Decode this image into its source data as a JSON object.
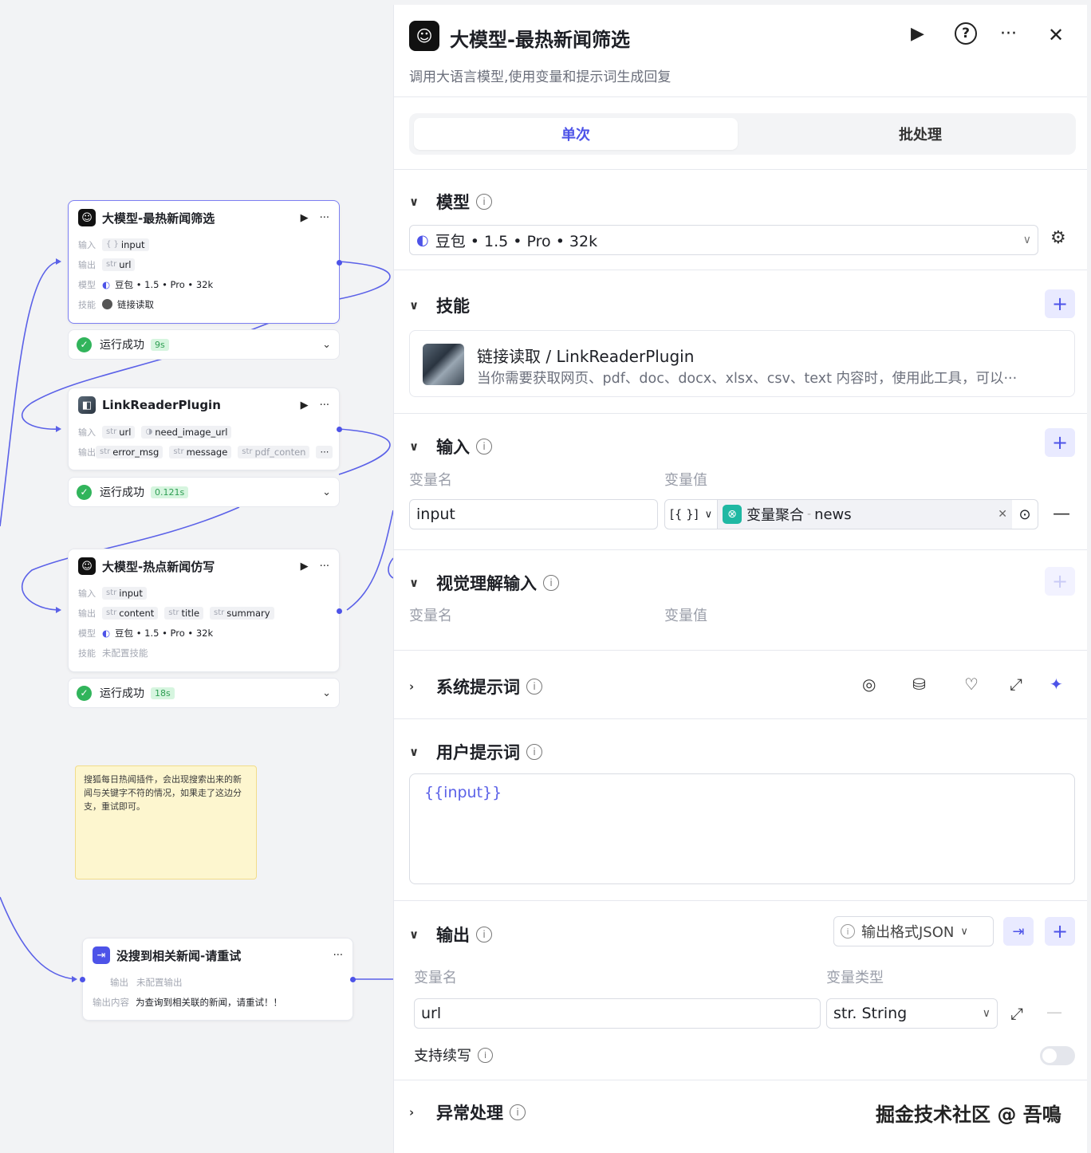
{
  "canvas": {
    "nodes": [
      {
        "title": "大模型-最热新闻筛选",
        "rows": [
          {
            "label": "输入",
            "items": [
              {
                "type": "{ }",
                "name": "input"
              }
            ]
          },
          {
            "label": "输出",
            "items": [
              {
                "type": "str",
                "name": "url"
              }
            ]
          },
          {
            "label": "模型",
            "text": "豆包 • 1.5 • Pro • 32k"
          },
          {
            "label": "技能",
            "text": "链接读取"
          }
        ],
        "status": "运行成功",
        "duration": "9s"
      },
      {
        "title": "LinkReaderPlugin",
        "rows": [
          {
            "label": "输入",
            "items": [
              {
                "type": "str",
                "name": "url"
              },
              {
                "type": "",
                "name": "need_image_url"
              }
            ]
          },
          {
            "label": "输出",
            "items": [
              {
                "type": "str",
                "name": "error_msg"
              },
              {
                "type": "str",
                "name": "message"
              },
              {
                "type": "str",
                "name": "pdf_conten"
              }
            ],
            "more": "···"
          }
        ],
        "status": "运行成功",
        "duration": "0.121s"
      },
      {
        "title": "大模型-热点新闻仿写",
        "rows": [
          {
            "label": "输入",
            "items": [
              {
                "type": "str",
                "name": "input"
              }
            ]
          },
          {
            "label": "输出",
            "items": [
              {
                "type": "str",
                "name": "content"
              },
              {
                "type": "str",
                "name": "title"
              },
              {
                "type": "str",
                "name": "summary"
              }
            ]
          },
          {
            "label": "模型",
            "text": "豆包 • 1.5 • Pro • 32k"
          },
          {
            "label": "技能",
            "text": "未配置技能"
          }
        ],
        "status": "运行成功",
        "duration": "18s"
      }
    ],
    "note": "搜狐每日热闻插件，会出现搜索出来的新闻与关键字不符的情况，如果走了这边分支，重试即可。",
    "end_node": {
      "title": "没搜到相关新闻-请重试",
      "output_label": "输出",
      "output_value": "未配置输出",
      "content_label": "输出内容",
      "content_value": "为查询到相关联的新闻，请重试！！"
    }
  },
  "panel": {
    "title": "大模型-最热新闻筛选",
    "description": "调用大语言模型,使用变量和提示词生成回复",
    "tabs": [
      "单次",
      "批处理"
    ],
    "model": {
      "section": "模型",
      "value": "豆包 • 1.5 • Pro • 32k"
    },
    "skills": {
      "section": "技能",
      "name": "链接读取 / LinkReaderPlugin",
      "desc": "当你需要获取网页、pdf、doc、docx、xlsx、csv、text 内容时，使用此工具，可以···"
    },
    "input": {
      "section": "输入",
      "col_name": "变量名",
      "col_value": "变量值",
      "var_name": "input",
      "type_glyph": "[{ }]",
      "ref_node": "变量聚合",
      "ref_sep": "-",
      "ref_var": "news"
    },
    "vision": {
      "section": "视觉理解输入",
      "col_name": "变量名",
      "col_value": "变量值"
    },
    "system_prompt": {
      "section": "系统提示词"
    },
    "user_prompt": {
      "section": "用户提示词",
      "value": "{{input}}"
    },
    "output": {
      "section": "输出",
      "format_label": "输出格式JSON",
      "col_name": "变量名",
      "col_type": "变量类型",
      "var_name": "url",
      "var_type": "str. String",
      "continue_label": "支持续写"
    },
    "exception": {
      "section": "异常处理"
    },
    "watermark": "掘金技术社区 @ 吾鳴"
  },
  "colors": {
    "accent": "#4d53e8",
    "success": "#31b45b",
    "edge": "#5b61e8"
  }
}
